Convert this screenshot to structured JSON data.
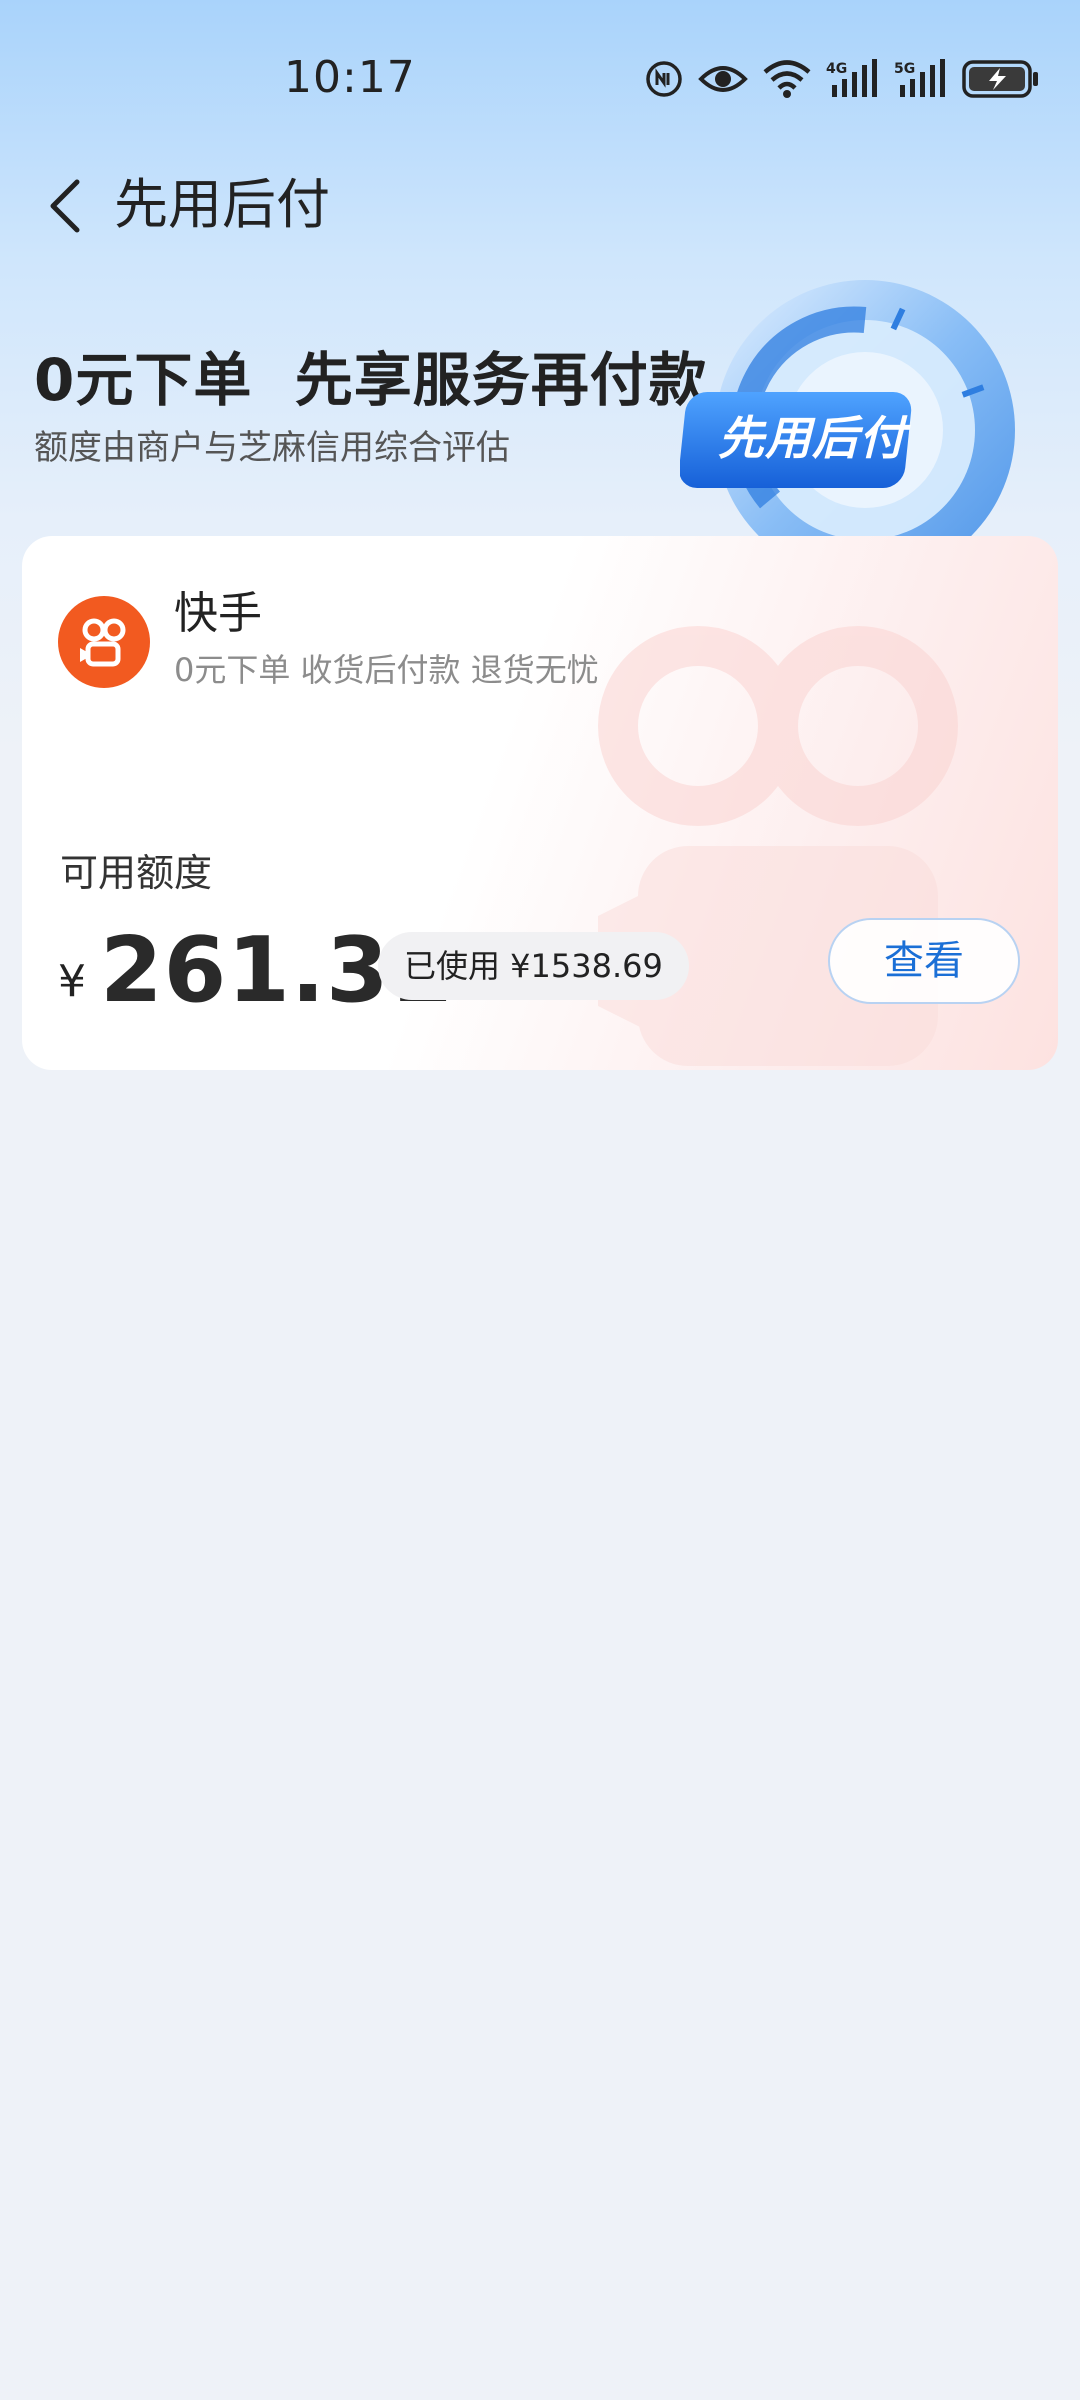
{
  "status_bar": {
    "time": "10:17",
    "icons": [
      "nfc-icon",
      "eye-icon",
      "wifi-icon",
      "signal-4g-icon",
      "signal-5g-icon",
      "battery-charging-icon"
    ],
    "network_1": "4G",
    "network_2": "5G"
  },
  "header": {
    "title": "先用后付"
  },
  "hero": {
    "title": "0元下单  先享服务再付款",
    "subtitle": "额度由商户与芝麻信用综合评估",
    "badge_label": "先用后付"
  },
  "card": {
    "merchant": {
      "name": "快手",
      "description": "0元下单 收货后付款 退货无忧",
      "brand_color": "#f25a20"
    },
    "credit_label": "可用额度",
    "currency_symbol": "¥",
    "available_amount": "261.31",
    "used_label": "已使用 ¥1538.69",
    "view_button": "查看"
  },
  "colors": {
    "accent": "#1b6fd6",
    "background": "#eef2f8"
  }
}
